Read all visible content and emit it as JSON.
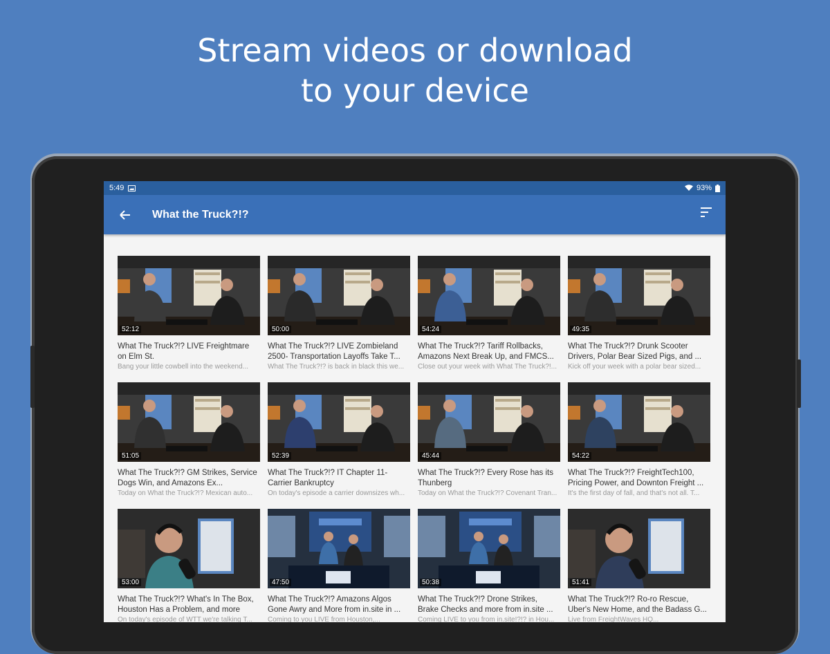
{
  "headline": {
    "line1": "Stream videos or download",
    "line2": "to your device"
  },
  "status": {
    "time": "5:49",
    "battery": "93%"
  },
  "toolbar": {
    "title": "What the Truck?!?"
  },
  "videos": [
    {
      "title": "What The Truck?!? LIVE Freightmare on Elm St.",
      "desc": "Bang your little cowbell into the weekend...",
      "duration": "52:12"
    },
    {
      "title": "What The Truck?!? LIVE Zombieland 2500- Transportation Layoffs Take T...",
      "desc": "What The Truck?!? is back in black this we...",
      "duration": "50:00"
    },
    {
      "title": "What The Truck?!? Tariff Rollbacks, Amazons Next Break Up, and FMCS...",
      "desc": "Close out your week with What The Truck?!...",
      "duration": "54:24"
    },
    {
      "title": "What The Truck?!? Drunk Scooter Drivers, Polar Bear Sized Pigs, and ...",
      "desc": "Kick off your week with a polar bear sized...",
      "duration": "49:35"
    },
    {
      "title": "What The Truck?!? GM Strikes, Service Dogs Win, and Amazons Ex...",
      "desc": "Today on What the Truck?!? Mexican auto...",
      "duration": "51:05"
    },
    {
      "title": "What The Truck?!? IT Chapter 11- Carrier Bankruptcy",
      "desc": "On today's episode a carrier downsizes wh...",
      "duration": "52:39"
    },
    {
      "title": "What The Truck?!? Every Rose has its Thunberg",
      "desc": "Today on What the Truck?!? Covenant Tran...",
      "duration": "45:44"
    },
    {
      "title": "What The Truck?!? FreightTech100, Pricing Power, and Downton Freight ...",
      "desc": "It's the first day of fall, and that's not all. T...",
      "duration": "54:22"
    },
    {
      "title": "What The Truck?!? What's In The Box, Houston Has a Problem, and more",
      "desc": "On today's episode of WTT we're talking T...",
      "duration": "53:00"
    },
    {
      "title": "What The Truck?!? Amazons Algos Gone Awry and More from in.site in ...",
      "desc": "Coming to you LIVE from Houston,...",
      "duration": "47:50"
    },
    {
      "title": "What The Truck?!? Drone Strikes, Brake Checks and more from in.site ...",
      "desc": "Coming LIVE to you from in.site!?!? in Hou...",
      "duration": "50:38"
    },
    {
      "title": "What The Truck?!? Ro-ro Rescue, Uber's New Home, and the Badass G...",
      "desc": "Live from FreightWaves HQ...",
      "duration": "51:41"
    }
  ],
  "colors": {
    "background": "#4f7fbf",
    "appbar": "#3a70b8",
    "statusbar": "#2a5f9e"
  }
}
